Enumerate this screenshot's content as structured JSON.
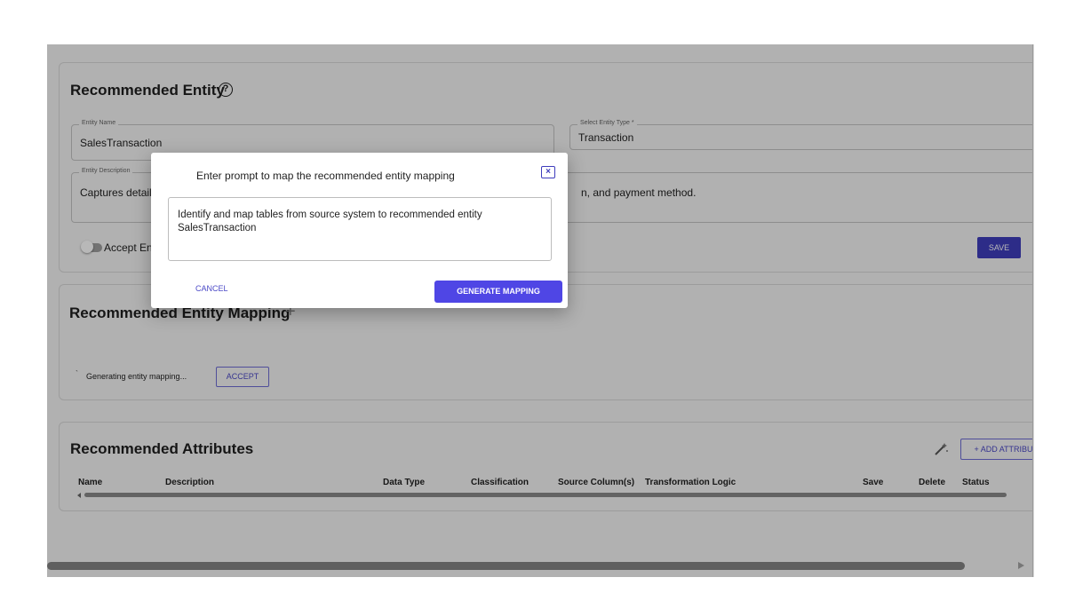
{
  "entity": {
    "heading": "Recommended Entity",
    "name_legend": "Entity Name",
    "name_value": "SalesTransaction",
    "type_legend": "Select Entity Type *",
    "type_value": "Transaction",
    "desc_legend": "Entity Description",
    "desc_value_left": "Captures detail",
    "desc_value_right": "n, and payment method.",
    "accept_label": "Accept Ent",
    "save_label": "SAVE"
  },
  "mapping": {
    "heading": "Recommended Entity Mapping",
    "add_symbol": "+",
    "status_text": "Generating entity mapping...",
    "accept_label": "ACCEPT"
  },
  "attributes": {
    "heading": "Recommended Attributes",
    "add_label": "+ ADD ATTRIBU",
    "columns": [
      "Name",
      "Description",
      "Data Type",
      "Classification",
      "Source Column(s)",
      "Transformation Logic",
      "Save",
      "Delete",
      "Status"
    ]
  },
  "dialog": {
    "title": "Enter prompt to map the recommended entity mapping",
    "close_symbol": "×",
    "prompt_line1": "Identify and map tables from source system to recommended entity",
    "prompt_line2": "SalesTransaction",
    "cancel_label": "CANCEL",
    "generate_label": "GENERATE MAPPING"
  },
  "icons": {
    "help": "help-circle-icon",
    "close": "close-icon",
    "wand": "magic-wand-icon"
  },
  "colors": {
    "primary": "#4f46e5",
    "save_button": "#3f3dbd"
  }
}
